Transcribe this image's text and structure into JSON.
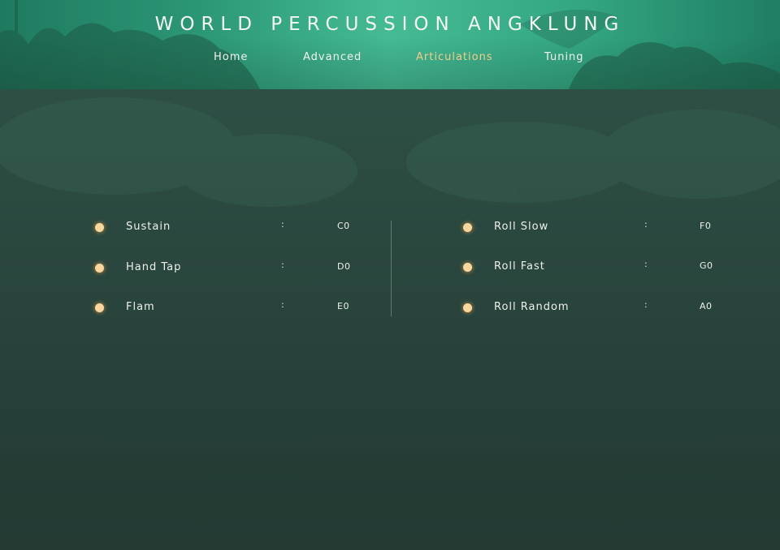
{
  "app": {
    "title": "WORLD PERCUSSION ANGKLUNG"
  },
  "nav": {
    "tabs": [
      {
        "label": "Home",
        "active": false
      },
      {
        "label": "Advanced",
        "active": false
      },
      {
        "label": "Articulations",
        "active": true
      },
      {
        "label": "Tuning",
        "active": false
      }
    ]
  },
  "articulations": {
    "separator": ":",
    "left": [
      {
        "name": "Sustain",
        "key": "C0"
      },
      {
        "name": "Hand Tap",
        "key": "D0"
      },
      {
        "name": "Flam",
        "key": "E0"
      }
    ],
    "right": [
      {
        "name": "Roll Slow",
        "key": "F0"
      },
      {
        "name": "Roll Fast",
        "key": "G0"
      },
      {
        "name": "Roll Random",
        "key": "A0"
      }
    ]
  },
  "colors": {
    "header_accent": "#45bb95",
    "active_tab": "#f2cd8c",
    "indicator": "#fbd7a0",
    "background": "#2b4a40"
  },
  "icons": {
    "indicator": "dot-indicator-icon"
  }
}
